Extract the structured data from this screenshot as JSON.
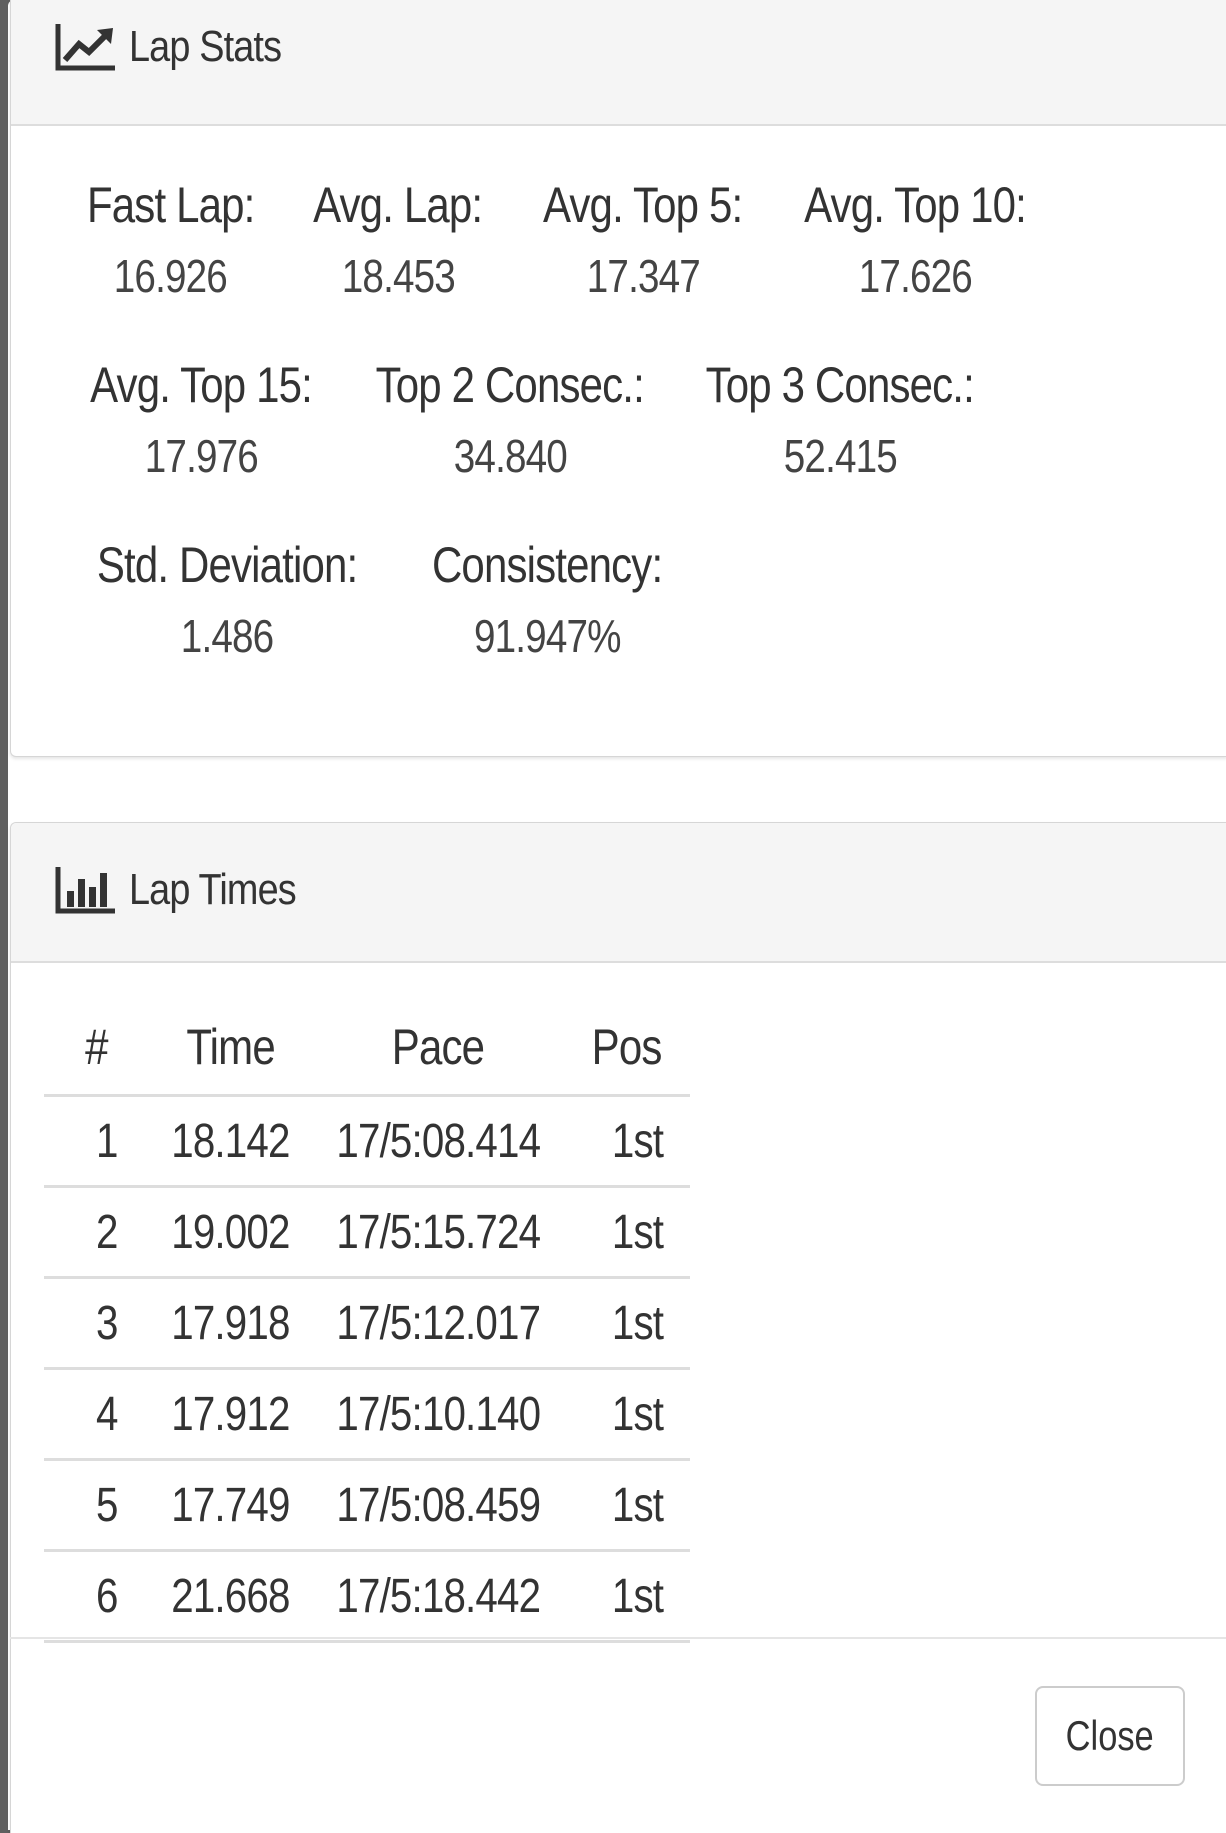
{
  "lap_stats": {
    "title": "Lap Stats",
    "icon": "line-chart-icon",
    "rows": [
      [
        {
          "label": "Fast Lap:",
          "value": "16.926"
        },
        {
          "label": "Avg. Lap:",
          "value": "18.453"
        },
        {
          "label": "Avg. Top 5:",
          "value": "17.347"
        },
        {
          "label": "Avg. Top 10:",
          "value": "17.626"
        }
      ],
      [
        {
          "label": "Avg. Top 15:",
          "value": "17.976"
        },
        {
          "label": "Top 2 Consec.:",
          "value": "34.840"
        },
        {
          "label": "Top 3 Consec.:",
          "value": "52.415"
        }
      ],
      [
        {
          "label": "Std. Deviation:",
          "value": "1.486"
        },
        {
          "label": "Consistency:",
          "value": "91.947%"
        }
      ]
    ]
  },
  "lap_times": {
    "title": "Lap Times",
    "icon": "bar-chart-icon",
    "columns": [
      "#",
      "Time",
      "Pace",
      "Pos"
    ],
    "rows": [
      [
        "1",
        "18.142",
        "17/5:08.414",
        "1st"
      ],
      [
        "2",
        "19.002",
        "17/5:15.724",
        "1st"
      ],
      [
        "3",
        "17.918",
        "17/5:12.017",
        "1st"
      ],
      [
        "4",
        "17.912",
        "17/5:10.140",
        "1st"
      ],
      [
        "5",
        "17.749",
        "17/5:08.459",
        "1st"
      ],
      [
        "6",
        "21.668",
        "17/5:18.442",
        "1st"
      ]
    ]
  },
  "footer": {
    "close_label": "Close"
  },
  "colors": {
    "heading_bg": "#f5f5f5",
    "border": "#dddddd",
    "text": "#333333",
    "backdrop": "#5f5f5f"
  }
}
